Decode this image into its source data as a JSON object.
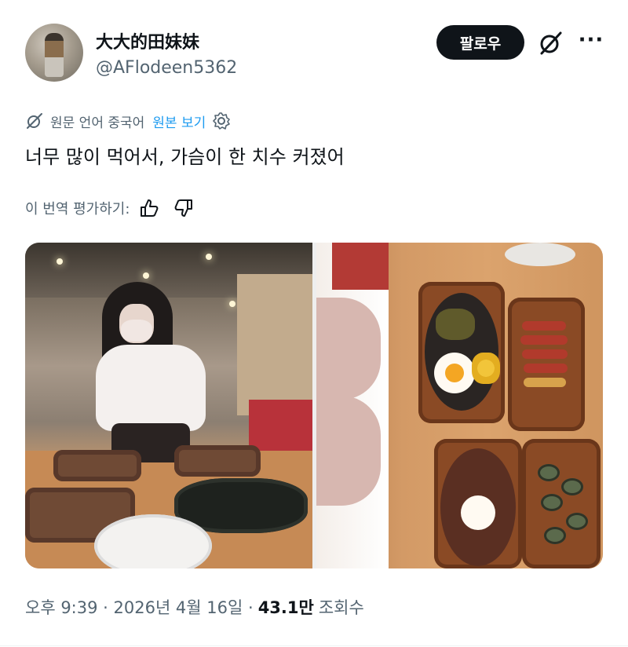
{
  "header": {
    "display_name": "大大的田妹妹",
    "handle": "@AFlodeen5362",
    "follow_label": "팔로우",
    "grok_icon": "grok-icon",
    "more_label": "···"
  },
  "translation": {
    "source_label": "원문 언어 중국어",
    "view_original_label": "원본 보기",
    "icons": [
      "translate-icon",
      "gear-icon"
    ]
  },
  "tweet": {
    "text": "너무 많이 먹어서, 가슴이 한 치수 커졌어"
  },
  "rating": {
    "label": "이 번역 평가하기:",
    "icons": [
      "thumbs-up-icon",
      "thumbs-down-icon"
    ]
  },
  "media": {
    "count": 2
  },
  "footer": {
    "timestamp": "오후 9:39 · 2026년 4월 16일 ·",
    "views_count": "43.1만",
    "views_label": "조회수"
  },
  "colors": {
    "text_primary": "#0f1419",
    "text_secondary": "#536471",
    "link": "#1d9bf0",
    "button_bg": "#0f1419"
  }
}
